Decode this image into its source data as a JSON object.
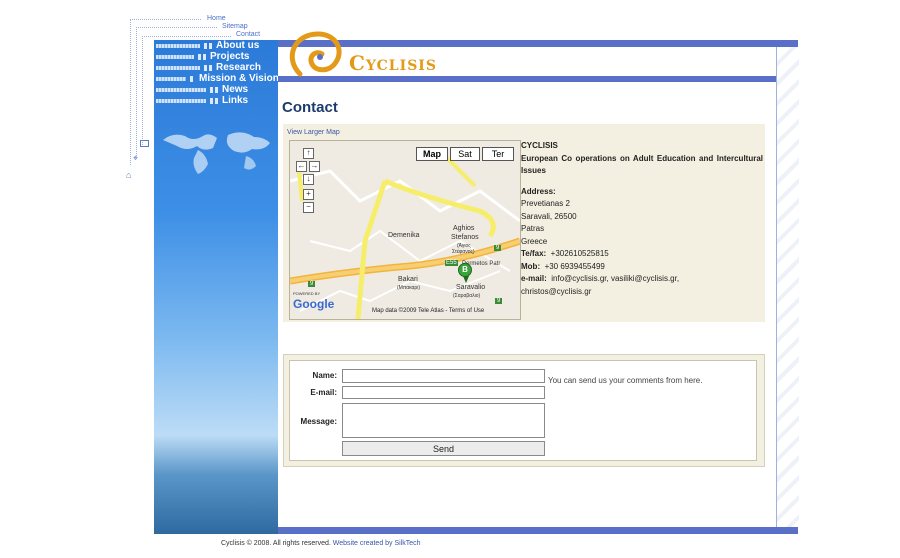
{
  "top_links": {
    "home": "Home",
    "sitemap": "Sitemap",
    "contact": "Contact"
  },
  "nav": [
    "About us",
    "Projects",
    "Research",
    "Mission & Vision",
    "News",
    "Links"
  ],
  "logo": {
    "text": "Cyclisis"
  },
  "page": {
    "title": "Contact",
    "larger_map": "View Larger Map"
  },
  "map": {
    "buttons": [
      "Map",
      "Sat",
      "Ter"
    ],
    "labels": {
      "demenika": "Demenika",
      "aghios": "Aghios",
      "stefanos": "Stefanos",
      "aghios_gr": "(Άγιος",
      "stefanos_gr": "Στέφανος)",
      "bakari": "Bakari",
      "bakari_gr": "(Μπακαρι)",
      "saravalio": "Saravalio",
      "saravalio_gr": "(Σαραβαλιο)",
      "e55": "E55",
      "permetos": "Permetos Patr",
      "road9a": "9",
      "road9b": "9",
      "road9c": "9",
      "powered": "POWERED BY",
      "google": "Google",
      "marker": "B",
      "attribution": "Map data ©2009 Tele Atlas - Terms of Use"
    }
  },
  "contact": {
    "org": "CYCLISIS",
    "desc": "European Co operations on Adult Education and Intercultural Issues",
    "address_label": "Address:",
    "address_lines": [
      "Prevetianas 2",
      "Saravali, 26500",
      "Patras",
      "Greece"
    ],
    "telfax_label": "Te/fax:",
    "telfax": "+302610525815",
    "mob_label": "Mob:",
    "mob": "+30 6939455499",
    "email_label": "e-mail:",
    "email1": "info@cyclisis.gr, vasiliki@cyclisis.gr,",
    "email2": "christos@cyclisis.gr"
  },
  "form": {
    "name_label": "Name:",
    "email_label": "E-mail:",
    "message_label": "Message:",
    "name_value": "",
    "email_value": "",
    "message_value": "",
    "hint": "You can send us your comments from here.",
    "send": "Send"
  },
  "footer": {
    "text": "Cyclisis © 2008. All rights reserved. ",
    "link": "Website created by SilkTech"
  },
  "colors": {
    "bar": "#5a6fc8",
    "logo": "#e39a18",
    "title": "#1d3c6e",
    "panel": "#f4f0e1"
  }
}
